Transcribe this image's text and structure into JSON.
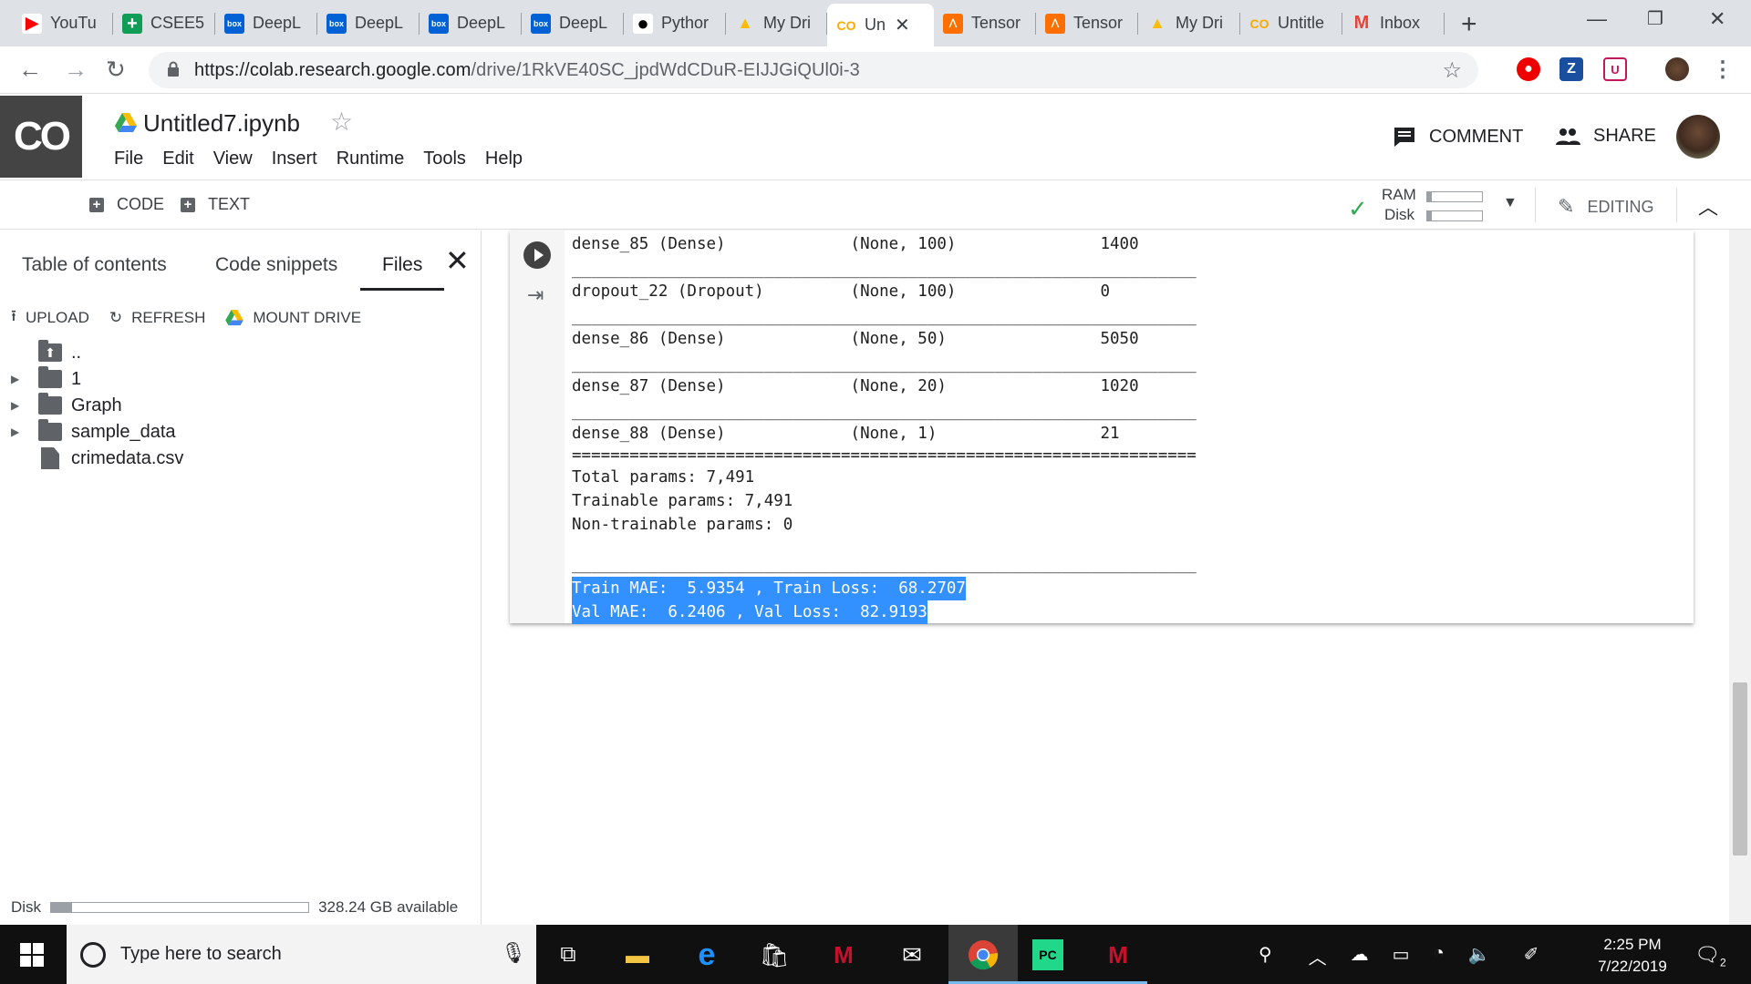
{
  "browser": {
    "tabs": [
      {
        "title": "YouTu",
        "icon": "youtube-icon"
      },
      {
        "title": "CSEE5",
        "icon": "sheets-icon"
      },
      {
        "title": "DeepL",
        "icon": "box-icon"
      },
      {
        "title": "DeepL",
        "icon": "box-icon"
      },
      {
        "title": "DeepL",
        "icon": "box-icon"
      },
      {
        "title": "DeepL",
        "icon": "box-icon"
      },
      {
        "title": "Pythor",
        "icon": "github-icon"
      },
      {
        "title": "My Dri",
        "icon": "drive-icon"
      },
      {
        "title": "Un",
        "icon": "colab-icon",
        "active": true
      },
      {
        "title": "Tensor",
        "icon": "tensorboard-icon"
      },
      {
        "title": "Tensor",
        "icon": "tensorboard-icon"
      },
      {
        "title": "My Dri",
        "icon": "drive-icon"
      },
      {
        "title": "Untitle",
        "icon": "colab-icon"
      },
      {
        "title": "Inbox",
        "icon": "gmail-icon"
      }
    ],
    "url_host": "https://colab.research.google.com",
    "url_path": "/drive/1RkVE40SC_jpdWdCDuR-EIJJGiQUl0i-3"
  },
  "colab": {
    "logo_text": "CO",
    "notebook_title": "Untitled7.ipynb",
    "menu": [
      "File",
      "Edit",
      "View",
      "Insert",
      "Runtime",
      "Tools",
      "Help"
    ],
    "comment_label": "COMMENT",
    "share_label": "SHARE",
    "code_btn": "CODE",
    "text_btn": "TEXT",
    "ram_label": "RAM",
    "disk_label": "Disk",
    "ram_fill": 0.08,
    "disk_fill": 0.08,
    "editing_label": "EDITING"
  },
  "sidepanel": {
    "tabs": [
      "Table of contents",
      "Code snippets",
      "Files"
    ],
    "active_tab": "Files",
    "actions": {
      "upload": "UPLOAD",
      "refresh": "REFRESH",
      "mount": "MOUNT DRIVE"
    },
    "files": [
      {
        "name": "..",
        "type": "parent"
      },
      {
        "name": "1",
        "type": "folder"
      },
      {
        "name": "Graph",
        "type": "folder"
      },
      {
        "name": "sample_data",
        "type": "folder"
      },
      {
        "name": "crimedata.csv",
        "type": "file"
      }
    ],
    "disk_label": "Disk",
    "disk_fill": 0.08,
    "disk_available": "328.24 GB available"
  },
  "output_lines": [
    "dense_85 (Dense)             (None, 100)               1400",
    "_________________________________________________________________",
    "dropout_22 (Dropout)         (None, 100)               0",
    "_________________________________________________________________",
    "dense_86 (Dense)             (None, 50)                5050",
    "_________________________________________________________________",
    "dense_87 (Dense)             (None, 20)                1020",
    "_________________________________________________________________",
    "dense_88 (Dense)             (None, 1)                 21",
    "=================================================================",
    "Total params: 7,491",
    "Trainable params: 7,491",
    "Non-trainable params: 0",
    "",
    "_________________________________________________________________",
    "Train MAE:  5.9354 , Train Loss:  68.2707",
    "Val MAE:  6.2406 , Val Loss:  82.9193"
  ],
  "highlighted_lines": [
    15,
    16
  ],
  "taskbar": {
    "search_placeholder": "Type here to search",
    "time": "2:25 PM",
    "date": "7/22/2019",
    "notification_count": "2"
  }
}
